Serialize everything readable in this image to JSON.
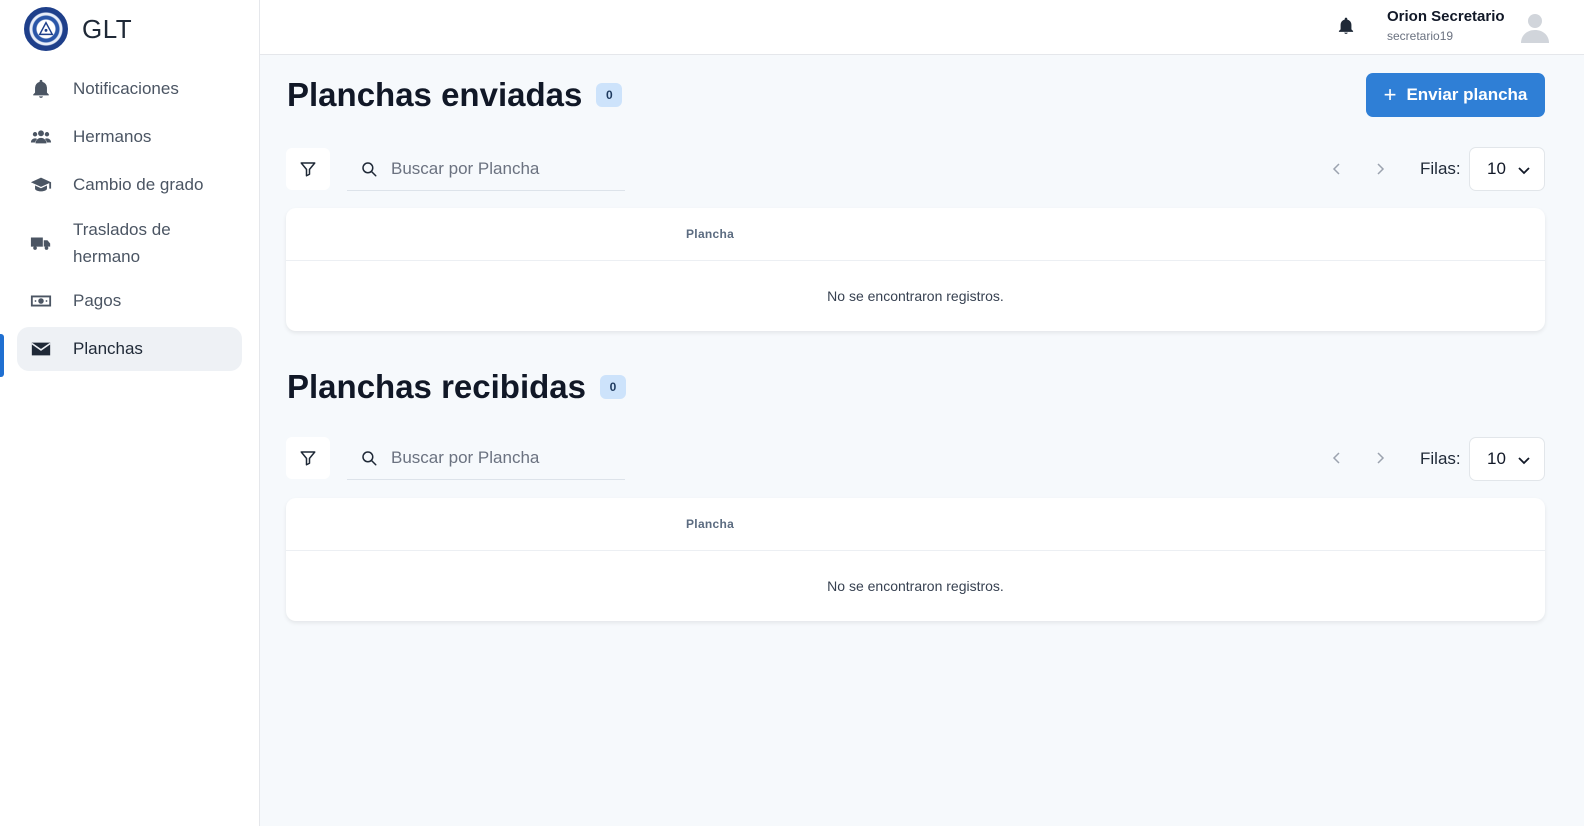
{
  "brand": {
    "name": "GLT"
  },
  "sidebar": {
    "items": [
      {
        "label": "Notificaciones",
        "icon": "bell-icon"
      },
      {
        "label": "Hermanos",
        "icon": "users-icon"
      },
      {
        "label": "Cambio de grado",
        "icon": "graduation-cap-icon"
      },
      {
        "label": "Traslados de hermano",
        "icon": "truck-icon"
      },
      {
        "label": "Pagos",
        "icon": "money-icon"
      },
      {
        "label": "Planchas",
        "icon": "envelope-icon",
        "active": true
      }
    ]
  },
  "header": {
    "user_name": "Orion Secretario",
    "user_id": "secretario19"
  },
  "sent": {
    "title": "Planchas enviadas",
    "count": "0",
    "send_button": "Enviar plancha",
    "search_placeholder": "Buscar por Plancha",
    "rows_label": "Filas:",
    "rows_value": "10",
    "column": "Plancha",
    "empty": "No se encontraron registros."
  },
  "received": {
    "title": "Planchas recibidas",
    "count": "0",
    "search_placeholder": "Buscar por Plancha",
    "rows_label": "Filas:",
    "rows_value": "10",
    "column": "Plancha",
    "empty": "No se encontraron registros."
  },
  "colors": {
    "accent": "#2f7fd6",
    "badge_bg": "#cde3fb",
    "active_bar": "#1f6fd1"
  }
}
